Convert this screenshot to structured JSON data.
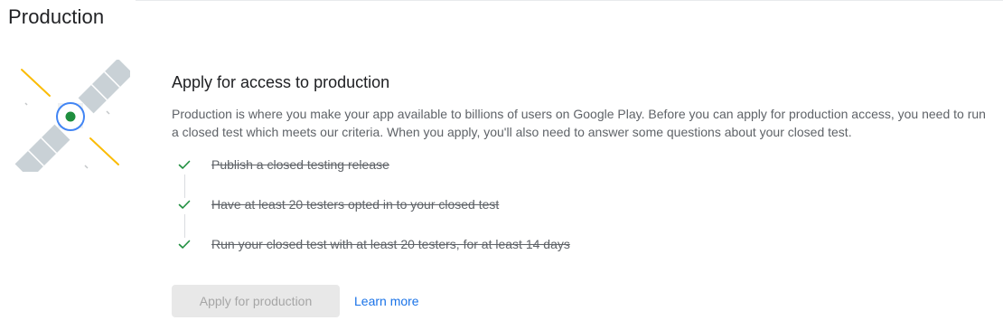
{
  "page": {
    "title": "Production"
  },
  "card": {
    "heading": "Apply for access to production",
    "description": "Production is where you make your app available to billions of users on Google Play. Before you can apply for production access, you need to run a closed test which meets our criteria. When you apply, you'll also need to answer some questions about your closed test."
  },
  "checklist": [
    {
      "label": "Publish a closed testing release",
      "completed": true,
      "icon": "checkmark-icon"
    },
    {
      "label": "Have at least 20 testers opted in to your closed test",
      "completed": true,
      "icon": "checkmark-icon"
    },
    {
      "label": "Run your closed test with at least 20 testers, for at least 14 days",
      "completed": true,
      "icon": "checkmark-icon"
    }
  ],
  "actions": {
    "apply_label": "Apply for production",
    "apply_disabled": true,
    "learn_more_label": "Learn more"
  },
  "illustration": {
    "icon": "satellite-icon"
  },
  "colors": {
    "check": "#1e8e3e",
    "link": "#1a73e8",
    "button_disabled_bg": "#e8e8e8",
    "button_disabled_text": "#a6a6a6",
    "satellite_panel": "#c9d1d6",
    "satellite_ring": "#4285f4",
    "satellite_core": "#1e8e3e",
    "beam": "#fbbc04"
  }
}
